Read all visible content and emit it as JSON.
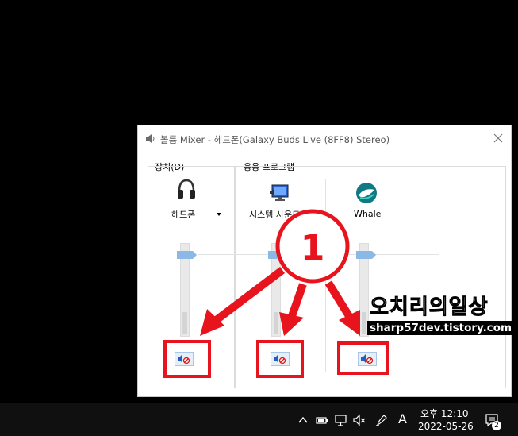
{
  "window": {
    "title": "볼륨 Mixer - 헤드폰(Galaxy Buds Live (8FF8) Stereo)",
    "icon": "speaker-icon",
    "close_icon": "close-icon"
  },
  "device_group": {
    "label": "장치(D)",
    "device_name": "헤드폰",
    "icon": "headphones-icon",
    "volume_level": 0.93,
    "muted": true
  },
  "apps_group": {
    "label": "응용 프로그램",
    "apps": [
      {
        "name": "시스템 사운드",
        "icon": "system-sounds-icon",
        "volume_level": 0.93,
        "muted": true
      },
      {
        "name": "Whale",
        "icon": "whale-browser-icon",
        "volume_level": 0.93,
        "muted": true
      }
    ]
  },
  "annotation": {
    "step_number": "1",
    "color": "#e8141d"
  },
  "watermark": {
    "title": "오치리의일상",
    "subtitle": "sharp57dev.tistory.com"
  },
  "taskbar": {
    "tray_icons": [
      "chevron-up-icon",
      "battery-icon",
      "network-icon",
      "volume-muted-icon",
      "pen-icon"
    ],
    "input_mode": "A",
    "time": "오후 12:10",
    "date": "2022-05-26",
    "notification_count": "2"
  }
}
